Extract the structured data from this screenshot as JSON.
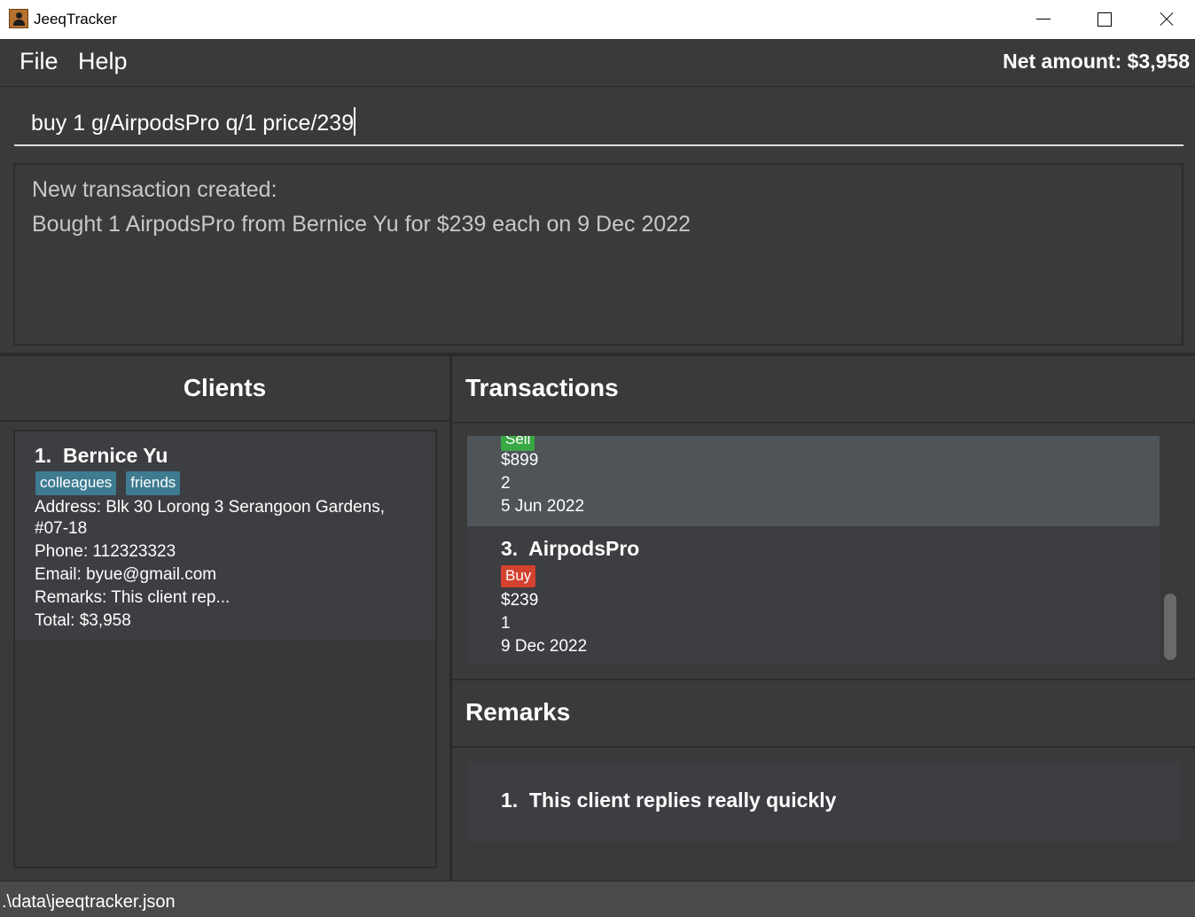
{
  "window": {
    "title": "JeeqTracker",
    "icon": "person-icon"
  },
  "menu": {
    "file_label": "File",
    "help_label": "Help",
    "net_amount": "Net amount: $3,958"
  },
  "command": {
    "value": "buy 1 g/AirpodsPro q/1 price/239"
  },
  "result": {
    "line1": "New transaction created:",
    "line2": "Bought 1 AirpodsPro from Bernice Yu for $239 each on 9 Dec 2022"
  },
  "clients": {
    "title": "Clients",
    "items": [
      {
        "index_name": "1.  Bernice Yu",
        "tags": [
          "colleagues",
          "friends"
        ],
        "address_line1": "Address: Blk 30 Lorong 3 Serangoon Gardens,",
        "address_line2": "#07-18",
        "phone": "Phone: 112323323",
        "email": "Email: byue@gmail.com",
        "remarks": "Remarks: This client rep...",
        "total": "Total: $3,958"
      }
    ]
  },
  "transactions": {
    "title": "Transactions",
    "items": [
      {
        "type": "Sell",
        "price": "$899",
        "quantity": "2",
        "date": "5 Jun 2022"
      },
      {
        "index_name": "3.  AirpodsPro",
        "type": "Buy",
        "price": "$239",
        "quantity": "1",
        "date": "9 Dec 2022"
      }
    ],
    "scroll_position": 0.9
  },
  "remarks": {
    "title": "Remarks",
    "items": [
      {
        "text": "1.  This client replies really quickly"
      }
    ]
  },
  "status": {
    "path": ".\\data\\jeeqtracker.json"
  },
  "colors": {
    "tag": "#3e7b91",
    "sell": "#3aa844",
    "buy": "#d3412f",
    "selected_card": "#4f5459"
  }
}
